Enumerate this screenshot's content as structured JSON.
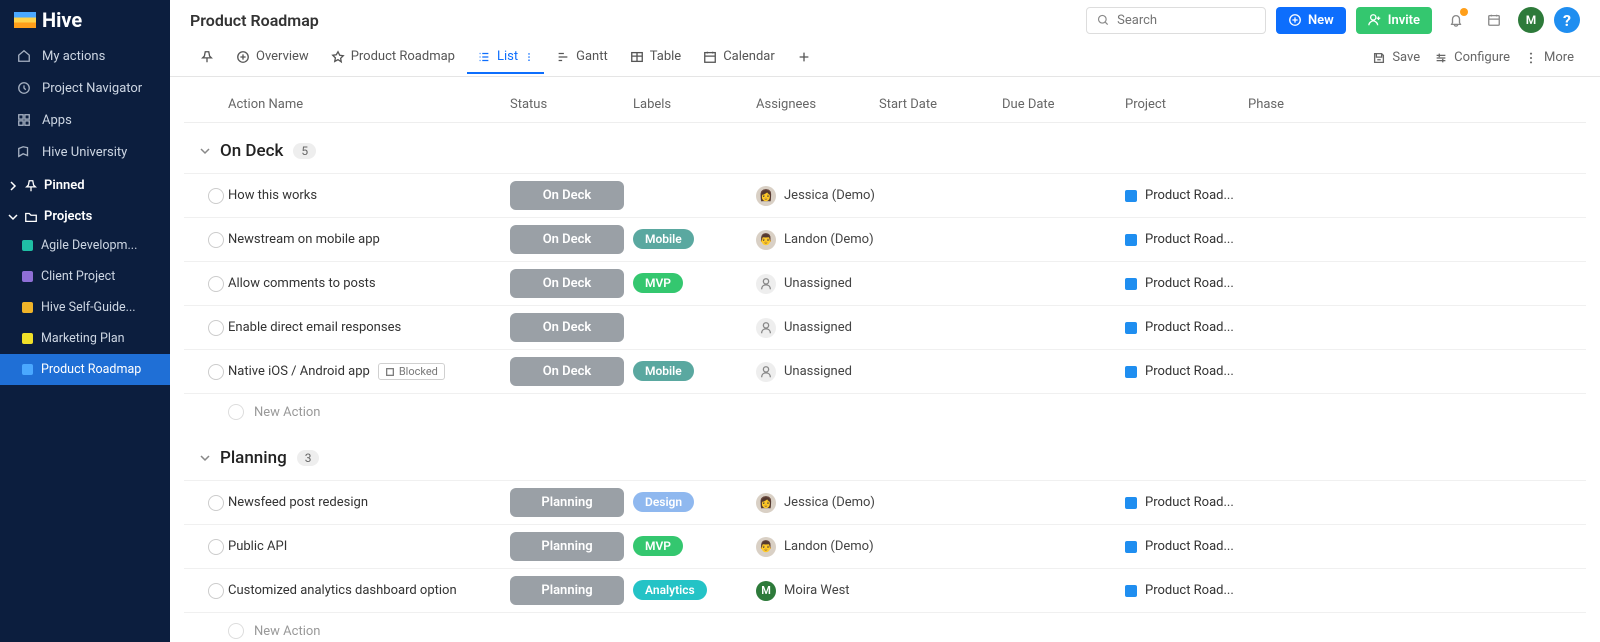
{
  "logo": "Hive",
  "nav": [
    {
      "label": "My actions"
    },
    {
      "label": "Project Navigator"
    },
    {
      "label": "Apps"
    },
    {
      "label": "Hive University"
    }
  ],
  "sections": {
    "pinned": "Pinned",
    "projects": "Projects"
  },
  "projects": [
    {
      "label": "Agile Developm...",
      "color": "#1fbfa5"
    },
    {
      "label": "Client Project",
      "color": "#8f6fd6"
    },
    {
      "label": "Hive Self-Guide...",
      "color": "#f0b429"
    },
    {
      "label": "Marketing Plan",
      "color": "#f0e029"
    },
    {
      "label": "Product Roadmap",
      "color": "#4aa8ff",
      "active": true
    }
  ],
  "page_title": "Product Roadmap",
  "search": {
    "placeholder": "Search"
  },
  "buttons": {
    "new": "New",
    "invite": "Invite"
  },
  "views": [
    {
      "label": "Overview"
    },
    {
      "label": "Product Roadmap"
    },
    {
      "label": "List",
      "active": true
    },
    {
      "label": "Gantt"
    },
    {
      "label": "Table"
    },
    {
      "label": "Calendar"
    }
  ],
  "view_actions": {
    "save": "Save",
    "configure": "Configure",
    "more": "More"
  },
  "columns": {
    "name": "Action Name",
    "status": "Status",
    "labels": "Labels",
    "assignees": "Assignees",
    "start": "Start Date",
    "due": "Due Date",
    "project": "Project",
    "phase": "Phase"
  },
  "groups": [
    {
      "title": "On Deck",
      "count": "5",
      "rows": [
        {
          "name": "How this works",
          "status": "On Deck",
          "labels": [],
          "blocked": false,
          "assignee": {
            "name": "Jessica (Demo)",
            "kind": "f"
          },
          "project": "Product Road..."
        },
        {
          "name": "Newstream on mobile app",
          "status": "On Deck",
          "labels": [
            {
              "text": "Mobile",
              "cls": "l-mobile"
            }
          ],
          "blocked": false,
          "assignee": {
            "name": "Landon (Demo)",
            "kind": "m"
          },
          "project": "Product Road..."
        },
        {
          "name": "Allow comments to posts",
          "status": "On Deck",
          "labels": [
            {
              "text": "MVP",
              "cls": "l-mvp"
            }
          ],
          "blocked": false,
          "assignee": {
            "name": "Unassigned",
            "kind": "u"
          },
          "project": "Product Road..."
        },
        {
          "name": "Enable direct email responses",
          "status": "On Deck",
          "labels": [],
          "blocked": false,
          "assignee": {
            "name": "Unassigned",
            "kind": "u"
          },
          "project": "Product Road..."
        },
        {
          "name": "Native iOS / Android app",
          "status": "On Deck",
          "labels": [
            {
              "text": "Mobile",
              "cls": "l-mobile"
            }
          ],
          "blocked": true,
          "blocked_text": "Blocked",
          "assignee": {
            "name": "Unassigned",
            "kind": "u"
          },
          "project": "Product Road..."
        }
      ]
    },
    {
      "title": "Planning",
      "count": "3",
      "rows": [
        {
          "name": "Newsfeed post redesign",
          "status": "Planning",
          "labels": [
            {
              "text": "Design",
              "cls": "l-design"
            }
          ],
          "blocked": false,
          "assignee": {
            "name": "Jessica (Demo)",
            "kind": "f"
          },
          "project": "Product Road..."
        },
        {
          "name": "Public API",
          "status": "Planning",
          "labels": [
            {
              "text": "MVP",
              "cls": "l-mvp"
            }
          ],
          "blocked": false,
          "assignee": {
            "name": "Landon (Demo)",
            "kind": "m"
          },
          "project": "Product Road..."
        },
        {
          "name": "Customized analytics dashboard option",
          "status": "Planning",
          "labels": [
            {
              "text": "Analytics",
              "cls": "l-analytics"
            }
          ],
          "blocked": false,
          "assignee": {
            "name": "Moira West",
            "kind": "mw",
            "initial": "M"
          },
          "project": "Product Road..."
        }
      ]
    }
  ],
  "new_action": "New Action",
  "avatar_initial": "M"
}
